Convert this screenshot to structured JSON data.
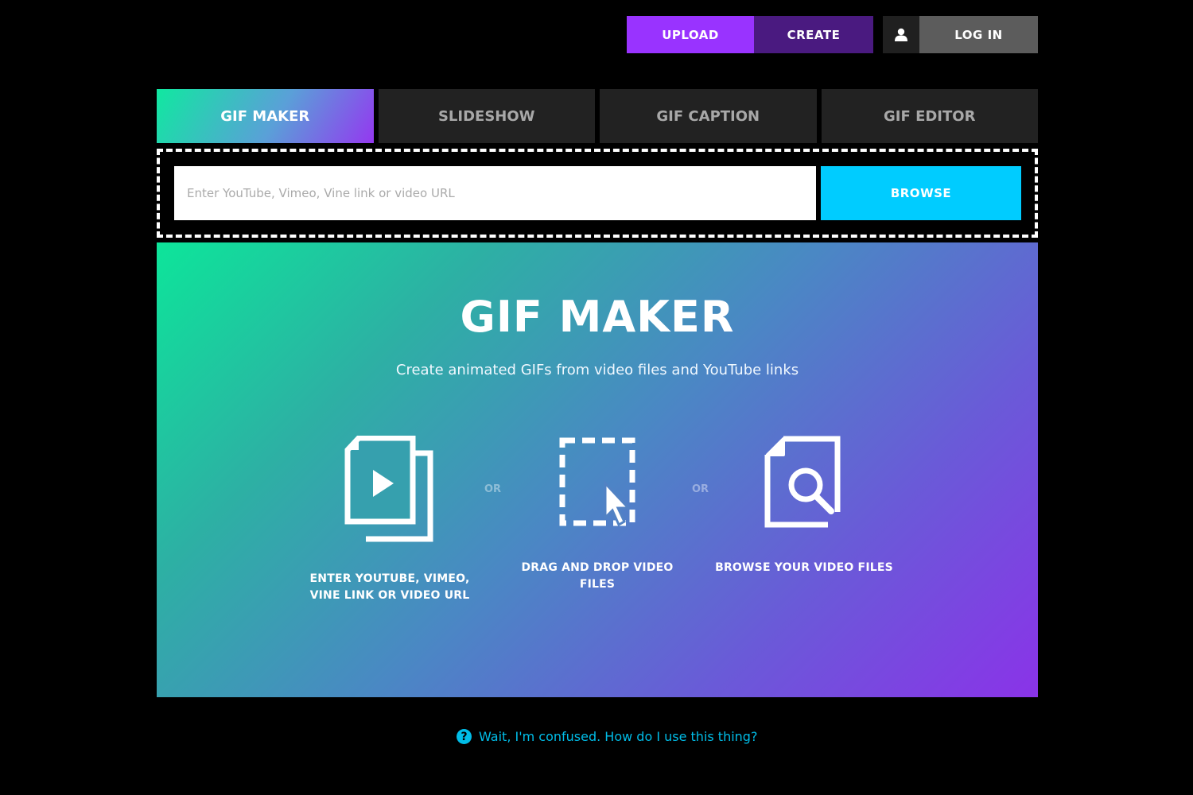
{
  "topnav": {
    "upload_label": "UPLOAD",
    "create_label": "CREATE",
    "user_icon": "user-icon",
    "login_label": "LOG IN"
  },
  "tabs": [
    {
      "label": "GIF MAKER",
      "active": true
    },
    {
      "label": "SLIDESHOW",
      "active": false
    },
    {
      "label": "GIF CAPTION",
      "active": false
    },
    {
      "label": "GIF EDITOR",
      "active": false
    }
  ],
  "url_form": {
    "value": "",
    "placeholder": "Enter YouTube, Vimeo, Vine link or video URL",
    "browse_label": "BROWSE"
  },
  "hero": {
    "title": "GIF MAKER",
    "subtitle": "Create animated GIFs from video files and YouTube links",
    "options": [
      {
        "icon": "video-files-icon",
        "label": "ENTER YOUTUBE, VIMEO, VINE LINK OR VIDEO URL"
      },
      {
        "icon": "drag-drop-icon",
        "label": "DRAG AND DROP VIDEO FILES"
      },
      {
        "icon": "browse-file-icon",
        "label": "BROWSE YOUR VIDEO FILES"
      }
    ],
    "separator": "OR"
  },
  "help": {
    "icon": "question-icon",
    "icon_glyph": "?",
    "text": "Wait, I'm confused. How do I use this thing?"
  },
  "colors": {
    "upload": "#9933ff",
    "create": "#4a1a80",
    "browse": "#00ccff",
    "help_link": "#00bde8",
    "gradient_start": "#0de59a",
    "gradient_end": "#8a33e8"
  }
}
